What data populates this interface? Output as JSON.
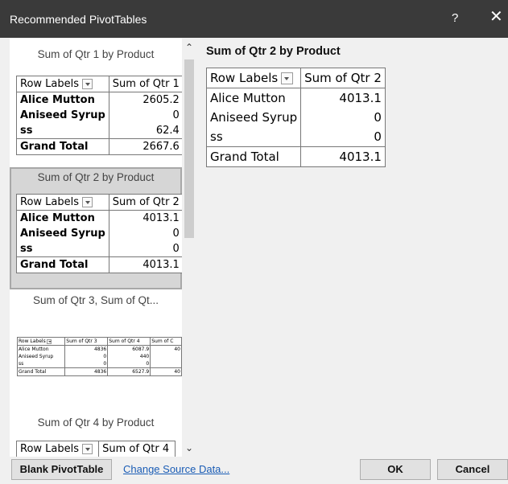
{
  "dialog": {
    "title": "Recommended PivotTables",
    "help": "?",
    "close": "✕"
  },
  "thumbnails": [
    {
      "caption": "Sum of Qtr 1 by Product",
      "headers": [
        "Row Labels",
        "Sum of Qtr 1"
      ],
      "rows": [
        [
          "Alice Mutton",
          "2605.2"
        ],
        [
          "Aniseed Syrup",
          "0"
        ],
        [
          "ss",
          "62.4"
        ]
      ],
      "total": [
        "Grand Total",
        "2667.6"
      ]
    },
    {
      "caption": "Sum of Qtr 2 by Product",
      "headers": [
        "Row Labels",
        "Sum of Qtr 2"
      ],
      "rows": [
        [
          "Alice Mutton",
          "4013.1"
        ],
        [
          "Aniseed Syrup",
          "0"
        ],
        [
          "ss",
          "0"
        ]
      ],
      "total": [
        "Grand Total",
        "4013.1"
      ]
    },
    {
      "caption": "Sum of Qtr 3, Sum of Qt...",
      "headers": [
        "Row Labels",
        "Sum of Qtr 3",
        "Sum of Qtr 4",
        "Sum of C"
      ],
      "rows": [
        [
          "Alice Mutton",
          "4836",
          "6087.9",
          "40"
        ],
        [
          "Aniseed Syrup",
          "0",
          "440",
          ""
        ],
        [
          "ss",
          "0",
          "0",
          ""
        ]
      ],
      "total": [
        "Grand Total",
        "4836",
        "6527.9",
        "40"
      ]
    },
    {
      "caption": "Sum of Qtr 4 by Product",
      "headers": [
        "Row Labels",
        "Sum of Qtr 4"
      ]
    }
  ],
  "preview": {
    "title": "Sum of Qtr 2 by Product",
    "headers": [
      "Row Labels",
      "Sum of Qtr 2"
    ],
    "rows": [
      [
        "Alice Mutton",
        "4013.1"
      ],
      [
        "Aniseed Syrup",
        "0"
      ],
      [
        "ss",
        "0"
      ]
    ],
    "total": [
      "Grand Total",
      "4013.1"
    ]
  },
  "footer": {
    "blank_label": "Blank PivotTable",
    "change_source_label": "Change Source Data...",
    "ok_label": "OK",
    "cancel_label": "Cancel"
  },
  "scrollbar": {
    "up": "⌃",
    "down": "⌄"
  }
}
